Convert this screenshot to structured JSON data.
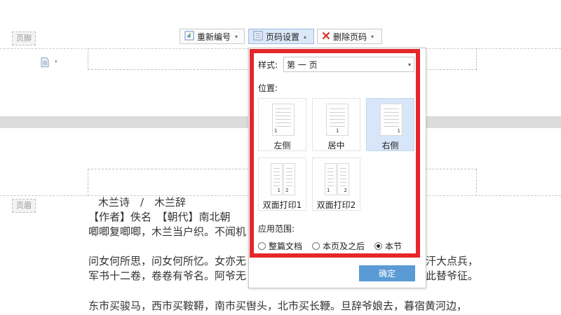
{
  "toolbar": {
    "renumber_label": "重新编号",
    "page_number_settings_label": "页码设置",
    "delete_page_number_label": "删除页码"
  },
  "zones": {
    "footer_tag": "页脚",
    "header_tag": "页眉"
  },
  "document": {
    "title_line": "木兰诗　/　木兰辞",
    "lines": [
      "【作者】佚名　【朝代】南北朝",
      "唧唧复唧唧，木兰当户织。不闻机",
      "",
      "问女何所思，问女何所忆。女亦无",
      "军书十二卷，卷卷有爷名。阿爷无",
      "",
      "东市买骏马，西市买鞍鞯，南市买辔头，北市买长鞭。旦辞爷娘去，暮宿黄河边，"
    ],
    "right_fragments": {
      "line4": "汗大点兵，",
      "line5": "此替爷征。"
    }
  },
  "popup": {
    "style_label": "样式:",
    "style_value": "第 一 页",
    "position_label": "位置:",
    "positions": [
      {
        "label": "左侧",
        "selected": false,
        "nums": [
          "1"
        ]
      },
      {
        "label": "居中",
        "selected": false,
        "nums": [
          "1"
        ]
      },
      {
        "label": "右侧",
        "selected": true,
        "nums": [
          "1"
        ]
      },
      {
        "label": "双面打印1",
        "selected": false,
        "nums": [
          "1",
          "2"
        ]
      },
      {
        "label": "双面打印2",
        "selected": false,
        "nums": [
          "1",
          "2"
        ]
      }
    ],
    "scope_label": "应用范围:",
    "scope_options": [
      {
        "label": "整篇文档",
        "selected": false
      },
      {
        "label": "本页及之后",
        "selected": false
      },
      {
        "label": "本节",
        "selected": true
      }
    ],
    "ok_label": "确定"
  },
  "colors": {
    "highlight_frame": "#e5262b",
    "ok_button": "#5b9bd5",
    "selected_card": "#d7e6f8"
  }
}
